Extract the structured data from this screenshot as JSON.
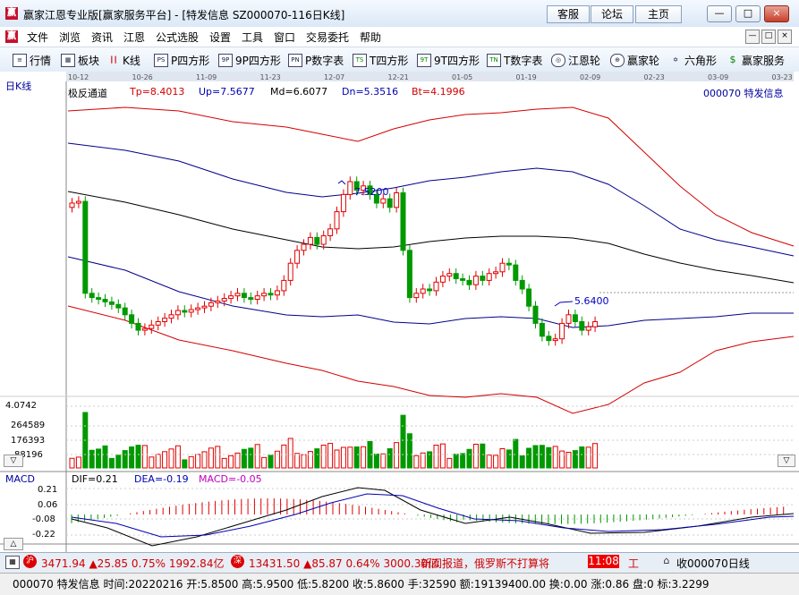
{
  "window": {
    "title": "赢家江恩专业版[赢家服务平台] - [特发信息  SZ000070-116日K线]",
    "buttons": [
      "客服",
      "论坛",
      "主页"
    ],
    "controls": [
      "—",
      "□",
      "×"
    ]
  },
  "menu": [
    "文件",
    "浏览",
    "资讯",
    "江恩",
    "公式选股",
    "设置",
    "工具",
    "窗口",
    "交易委托",
    "帮助"
  ],
  "toolbar": [
    {
      "label": "行情",
      "icon": "quote-icon"
    },
    {
      "label": "板块",
      "icon": "sector-icon"
    },
    {
      "label": "K线",
      "icon": "kline-icon"
    },
    {
      "label": "P四方形",
      "icon": "P"
    },
    {
      "label": "9P四方形",
      "icon": "9P"
    },
    {
      "label": "P数字表",
      "icon": "P"
    },
    {
      "label": "T四方形",
      "icon": "T"
    },
    {
      "label": "9T四方形",
      "icon": "9T"
    },
    {
      "label": "T数字表",
      "icon": "TN"
    },
    {
      "label": "江恩轮",
      "icon": "gann-wheel-icon"
    },
    {
      "label": "赢家轮",
      "icon": "winner-wheel-icon"
    },
    {
      "label": "六角形",
      "icon": "hexagon-icon"
    },
    {
      "label": "赢家服务",
      "icon": "dollar-icon"
    }
  ],
  "chart": {
    "period_label": "日K线",
    "date_ticks": [
      "10-12",
      "10-26",
      "11-09",
      "11-23",
      "12-07",
      "12-21",
      "01-05",
      "01-19",
      "02-09",
      "02-23",
      "03-09",
      "03-23"
    ],
    "indicator": {
      "name": "极反通道",
      "tp": "Tp=8.4013",
      "up": "Up=7.5677",
      "md": "Md=6.6077",
      "dn": "Dn=5.3516",
      "bt": "Bt=4.1996"
    },
    "stock_label": "000070  特发信息",
    "high_marker": "7.5200",
    "low_marker": "5.6400",
    "volume_ticks": [
      "4.0742",
      "264589",
      "176393",
      "88196"
    ],
    "macd": {
      "name": "MACD",
      "dif": "DIF=0.21",
      "dea": "DEA=-0.19",
      "macd": "MACD=-0.05",
      "ticks": [
        "0.21",
        "0.06",
        "-0.08",
        "-0.22"
      ]
    },
    "colors": {
      "up": "#e00000",
      "down": "#009900",
      "mid": "#000000",
      "band": "#00008b",
      "outer": "#d40000"
    }
  },
  "statusbar": {
    "sh_index": "3471.94",
    "sh_change": "▲25.85",
    "sh_pct": "0.75%",
    "sh_amount": "1992.84亿",
    "sz_index": "13431.50",
    "sz_change": "▲85.87",
    "sz_pct": "0.64%",
    "sz_amount": "3000.30亿",
    "news": "新闻报道，俄罗斯不打算将",
    "time": "11:08",
    "tool_label": "工",
    "favorite": "收000070日线"
  },
  "bottombar": {
    "text": "000070 特发信息 时间:20220216 开:5.8500 高:5.9500 低:5.8200 收:5.8600 手:32590 额:19139400.00 换:0.00 涨:0.86 盘:0 标:3.2299"
  }
}
